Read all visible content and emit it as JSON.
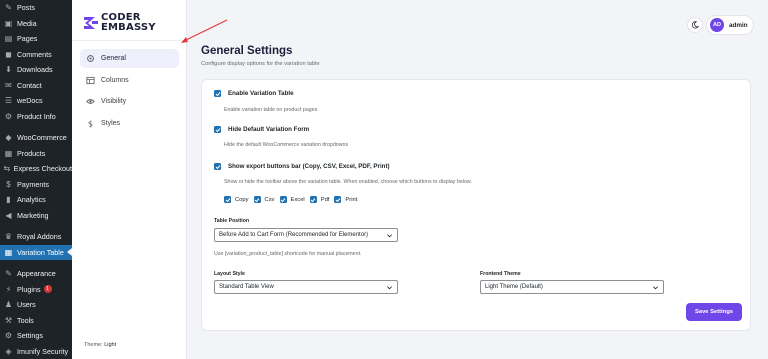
{
  "wp_menu": [
    {
      "icon": "pin-icon",
      "glyph": "✎",
      "label": "Posts"
    },
    {
      "icon": "media-icon",
      "glyph": "▣",
      "label": "Media"
    },
    {
      "icon": "page-icon",
      "glyph": "▤",
      "label": "Pages"
    },
    {
      "icon": "comment-icon",
      "glyph": "◼",
      "label": "Comments"
    },
    {
      "icon": "download-icon",
      "glyph": "⬇",
      "label": "Downloads"
    },
    {
      "icon": "mail-icon",
      "glyph": "✉",
      "label": "Contact"
    },
    {
      "icon": "docs-icon",
      "glyph": "☰",
      "label": "weDocs"
    },
    {
      "icon": "gear-icon",
      "glyph": "⚙",
      "label": "Product Info"
    },
    {
      "sep": true
    },
    {
      "icon": "woo-icon",
      "glyph": "◆",
      "label": "WooCommerce"
    },
    {
      "icon": "products-icon",
      "glyph": "▦",
      "label": "Products"
    },
    {
      "icon": "checkout-icon",
      "glyph": "⇆",
      "label": "Express Checkout"
    },
    {
      "icon": "payments-icon",
      "glyph": "$",
      "label": "Payments"
    },
    {
      "icon": "analytics-icon",
      "glyph": "▮",
      "label": "Analytics"
    },
    {
      "icon": "megaphone-icon",
      "glyph": "◀",
      "label": "Marketing"
    },
    {
      "sep": true
    },
    {
      "icon": "crown-icon",
      "glyph": "♛",
      "label": "Royal Addons"
    },
    {
      "icon": "table-icon",
      "glyph": "▦",
      "label": "Variation Table",
      "active": true
    },
    {
      "sep": true
    },
    {
      "icon": "brush-icon",
      "glyph": "✎",
      "label": "Appearance"
    },
    {
      "icon": "plugin-icon",
      "glyph": "⚡",
      "label": "Plugins",
      "badge": "1"
    },
    {
      "icon": "users-icon",
      "glyph": "♟",
      "label": "Users"
    },
    {
      "icon": "wrench-icon",
      "glyph": "⚒",
      "label": "Tools"
    },
    {
      "icon": "settings-icon",
      "glyph": "⚙",
      "label": "Settings"
    },
    {
      "icon": "shield-icon",
      "glyph": "◈",
      "label": "Imunify Security"
    }
  ],
  "brand": {
    "line1": "CODER",
    "line2": "EMBASSY"
  },
  "nav": [
    {
      "name": "nav-item-general",
      "icon": "gear-icon",
      "label": "General",
      "active": true
    },
    {
      "name": "nav-item-columns",
      "icon": "columns-icon",
      "label": "Columns"
    },
    {
      "name": "nav-item-visibility",
      "icon": "eye-icon",
      "label": "Visibility"
    },
    {
      "name": "nav-item-styles",
      "icon": "dollar-icon",
      "label": "Styles"
    }
  ],
  "footer": {
    "prefix": "Theme:",
    "theme": "Light"
  },
  "header": {
    "avatar_initials": "AD",
    "user_name": "admin"
  },
  "page": {
    "title": "General Settings",
    "subtitle": "Configure display options for the variation table"
  },
  "settings": {
    "enable_table": {
      "label": "Enable Variation Table",
      "desc": "Enable variation table on product pages",
      "checked": true
    },
    "hide_default": {
      "label": "Hide Default Variation Form",
      "desc": "Hide the default WooCommerce variation dropdowns",
      "checked": true
    },
    "export": {
      "label": "Show export buttons bar (Copy, CSV, Excel, PDF, Print)",
      "desc": "Show or hide the toolbar above the variation table. When enabled, choose which buttons to display below.",
      "checked": true
    },
    "export_buttons": [
      {
        "label": "Copy",
        "checked": true
      },
      {
        "label": "Csv",
        "checked": true
      },
      {
        "label": "Excel",
        "checked": true
      },
      {
        "label": "Pdf",
        "checked": true
      },
      {
        "label": "Print",
        "checked": true
      }
    ],
    "table_position": {
      "label": "Table Position",
      "value": "Before Add to Cart Form (Recommended for Elementor)",
      "help": "Use [variation_product_table] shortcode for manual placement."
    },
    "layout_style": {
      "label": "Layout Style",
      "value": "Standard Table View"
    },
    "frontend_theme": {
      "label": "Frontend Theme",
      "value": "Light Theme (Default)"
    },
    "save_label": "Save Settings"
  },
  "colors": {
    "accent": "#6f46e8",
    "wp_active": "#2271b1",
    "checkbox": "#2271b1",
    "annotation_arrow": "#e53935"
  }
}
